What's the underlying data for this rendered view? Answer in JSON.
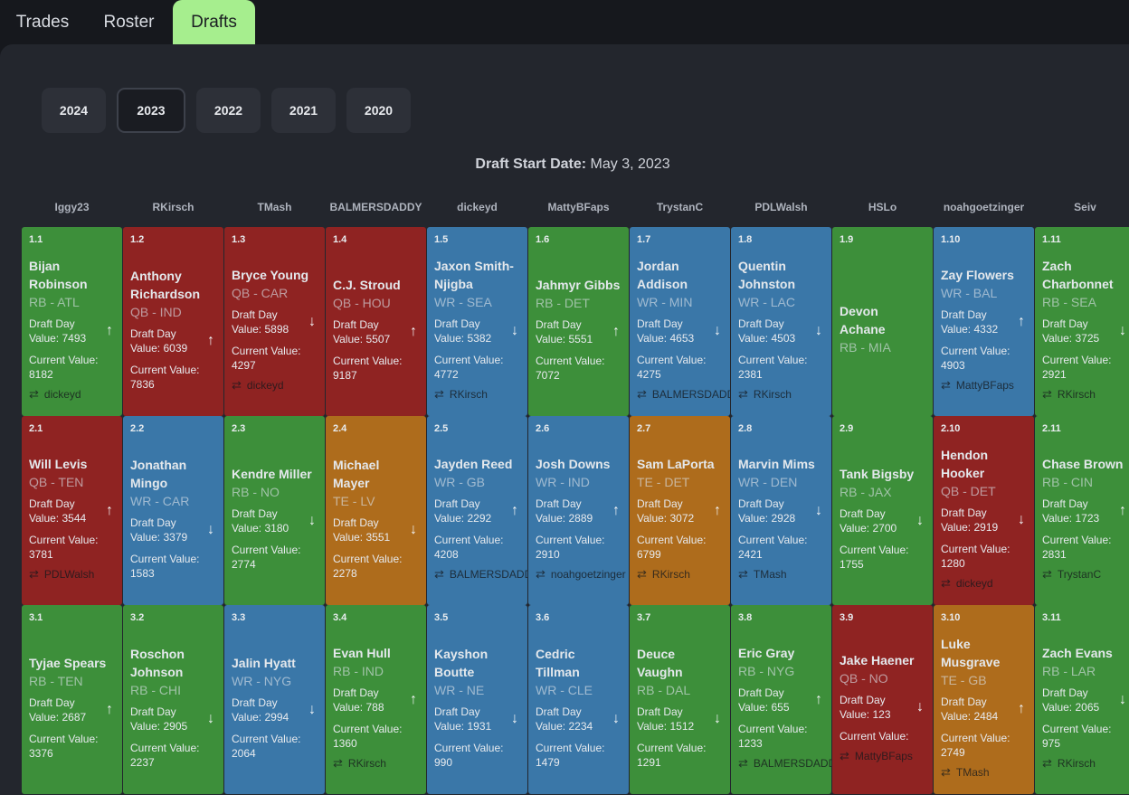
{
  "nav": {
    "tabs": [
      {
        "label": "Trades"
      },
      {
        "label": "Roster"
      },
      {
        "label": "Drafts"
      }
    ]
  },
  "years": [
    "2024",
    "2023",
    "2022",
    "2021",
    "2020"
  ],
  "selected_year": "2023",
  "draft_start": {
    "label": "Draft Start Date:",
    "value": "May 3, 2023"
  },
  "labels": {
    "draft_day": "Draft Day Value:",
    "current": "Current Value:"
  },
  "colors": {
    "RB": "#3d8f3a",
    "QB": "#8f2322",
    "WR": "#3a77a8",
    "TE": "#ae6c1c",
    "active_tab": "#a6ee8e"
  },
  "teams": [
    "Iggy23",
    "RKirsch",
    "TMash",
    "BALMERSDADDY",
    "dickeyd",
    "MattyBFaps",
    "TrystanC",
    "PDLWalsh",
    "HSLo",
    "noahgoetzinger",
    "Seiv"
  ],
  "rounds": [
    [
      {
        "pick": "1.1",
        "name": "Bijan Robinson",
        "pos": "RB - ATL",
        "type": "RB",
        "draft_value": "7493",
        "dir": "up",
        "current_value": "8182",
        "traded_from": "dickeyd"
      },
      {
        "pick": "1.2",
        "name": "Anthony Richardson",
        "pos": "QB - IND",
        "type": "QB",
        "draft_value": "6039",
        "dir": "up",
        "current_value": "7836",
        "traded_from": ""
      },
      {
        "pick": "1.3",
        "name": "Bryce Young",
        "pos": "QB - CAR",
        "type": "QB",
        "draft_value": "5898",
        "dir": "down",
        "current_value": "4297",
        "traded_from": "dickeyd"
      },
      {
        "pick": "1.4",
        "name": "C.J. Stroud",
        "pos": "QB - HOU",
        "type": "QB",
        "draft_value": "5507",
        "dir": "up",
        "current_value": "9187",
        "traded_from": ""
      },
      {
        "pick": "1.5",
        "name": "Jaxon Smith-Njigba",
        "pos": "WR - SEA",
        "type": "WR",
        "draft_value": "5382",
        "dir": "down",
        "current_value": "4772",
        "traded_from": "RKirsch"
      },
      {
        "pick": "1.6",
        "name": "Jahmyr Gibbs",
        "pos": "RB - DET",
        "type": "RB",
        "draft_value": "5551",
        "dir": "up",
        "current_value": "7072",
        "traded_from": ""
      },
      {
        "pick": "1.7",
        "name": "Jordan Addison",
        "pos": "WR - MIN",
        "type": "WR",
        "draft_value": "4653",
        "dir": "down",
        "current_value": "4275",
        "traded_from": "BALMERSDADDY"
      },
      {
        "pick": "1.8",
        "name": "Quentin Johnston",
        "pos": "WR - LAC",
        "type": "WR",
        "draft_value": "4503",
        "dir": "down",
        "current_value": "2381",
        "traded_from": "RKirsch"
      },
      {
        "pick": "1.9",
        "name": "Devon Achane",
        "pos": "RB - MIA",
        "type": "RB",
        "draft_value": "",
        "dir": "",
        "current_value": "",
        "traded_from": ""
      },
      {
        "pick": "1.10",
        "name": "Zay Flowers",
        "pos": "WR - BAL",
        "type": "WR",
        "draft_value": "4332",
        "dir": "up",
        "current_value": "4903",
        "traded_from": "MattyBFaps"
      },
      {
        "pick": "1.11",
        "name": "Zach Charbonnet",
        "pos": "RB - SEA",
        "type": "RB",
        "draft_value": "3725",
        "dir": "down",
        "current_value": "2921",
        "traded_from": "RKirsch"
      }
    ],
    [
      {
        "pick": "2.1",
        "name": "Will Levis",
        "pos": "QB - TEN",
        "type": "QB",
        "draft_value": "3544",
        "dir": "up",
        "current_value": "3781",
        "traded_from": "PDLWalsh"
      },
      {
        "pick": "2.2",
        "name": "Jonathan Mingo",
        "pos": "WR - CAR",
        "type": "WR",
        "draft_value": "3379",
        "dir": "down",
        "current_value": "1583",
        "traded_from": ""
      },
      {
        "pick": "2.3",
        "name": "Kendre Miller",
        "pos": "RB - NO",
        "type": "RB",
        "draft_value": "3180",
        "dir": "down",
        "current_value": "2774",
        "traded_from": ""
      },
      {
        "pick": "2.4",
        "name": "Michael Mayer",
        "pos": "TE - LV",
        "type": "TE",
        "draft_value": "3551",
        "dir": "down",
        "current_value": "2278",
        "traded_from": ""
      },
      {
        "pick": "2.5",
        "name": "Jayden Reed",
        "pos": "WR - GB",
        "type": "WR",
        "draft_value": "2292",
        "dir": "up",
        "current_value": "4208",
        "traded_from": "BALMERSDADDY"
      },
      {
        "pick": "2.6",
        "name": "Josh Downs",
        "pos": "WR - IND",
        "type": "WR",
        "draft_value": "2889",
        "dir": "up",
        "current_value": "2910",
        "traded_from": "noahgoetzinger"
      },
      {
        "pick": "2.7",
        "name": "Sam LaPorta",
        "pos": "TE - DET",
        "type": "TE",
        "draft_value": "3072",
        "dir": "up",
        "current_value": "6799",
        "traded_from": "RKirsch"
      },
      {
        "pick": "2.8",
        "name": "Marvin Mims",
        "pos": "WR - DEN",
        "type": "WR",
        "draft_value": "2928",
        "dir": "down",
        "current_value": "2421",
        "traded_from": "TMash"
      },
      {
        "pick": "2.9",
        "name": "Tank Bigsby",
        "pos": "RB - JAX",
        "type": "RB",
        "draft_value": "2700",
        "dir": "down",
        "current_value": "1755",
        "traded_from": ""
      },
      {
        "pick": "2.10",
        "name": "Hendon Hooker",
        "pos": "QB - DET",
        "type": "QB",
        "draft_value": "2919",
        "dir": "down",
        "current_value": "1280",
        "traded_from": "dickeyd"
      },
      {
        "pick": "2.11",
        "name": "Chase Brown",
        "pos": "RB - CIN",
        "type": "RB",
        "draft_value": "1723",
        "dir": "up",
        "current_value": "2831",
        "traded_from": "TrystanC"
      }
    ],
    [
      {
        "pick": "3.1",
        "name": "Tyjae Spears",
        "pos": "RB - TEN",
        "type": "RB",
        "draft_value": "2687",
        "dir": "up",
        "current_value": "3376",
        "traded_from": ""
      },
      {
        "pick": "3.2",
        "name": "Roschon Johnson",
        "pos": "RB - CHI",
        "type": "RB",
        "draft_value": "2905",
        "dir": "down",
        "current_value": "2237",
        "traded_from": ""
      },
      {
        "pick": "3.3",
        "name": "Jalin Hyatt",
        "pos": "WR - NYG",
        "type": "WR",
        "draft_value": "2994",
        "dir": "down",
        "current_value": "2064",
        "traded_from": ""
      },
      {
        "pick": "3.4",
        "name": "Evan Hull",
        "pos": "RB - IND",
        "type": "RB",
        "draft_value": "788",
        "dir": "up",
        "current_value": "1360",
        "traded_from": "RKirsch"
      },
      {
        "pick": "3.5",
        "name": "Kayshon Boutte",
        "pos": "WR - NE",
        "type": "WR",
        "draft_value": "1931",
        "dir": "down",
        "current_value": "990",
        "traded_from": ""
      },
      {
        "pick": "3.6",
        "name": "Cedric Tillman",
        "pos": "WR - CLE",
        "type": "WR",
        "draft_value": "2234",
        "dir": "down",
        "current_value": "1479",
        "traded_from": ""
      },
      {
        "pick": "3.7",
        "name": "Deuce Vaughn",
        "pos": "RB - DAL",
        "type": "RB",
        "draft_value": "1512",
        "dir": "down",
        "current_value": "1291",
        "traded_from": ""
      },
      {
        "pick": "3.8",
        "name": "Eric Gray",
        "pos": "RB - NYG",
        "type": "RB",
        "draft_value": "655",
        "dir": "up",
        "current_value": "1233",
        "traded_from": "BALMERSDADDY"
      },
      {
        "pick": "3.9",
        "name": "Jake Haener",
        "pos": "QB - NO",
        "type": "QB",
        "draft_value": "123",
        "dir": "down",
        "current_value": "",
        "traded_from": "MattyBFaps"
      },
      {
        "pick": "3.10",
        "name": "Luke Musgrave",
        "pos": "TE - GB",
        "type": "TE",
        "draft_value": "2484",
        "dir": "up",
        "current_value": "2749",
        "traded_from": "TMash"
      },
      {
        "pick": "3.11",
        "name": "Zach Evans",
        "pos": "RB - LAR",
        "type": "RB",
        "draft_value": "2065",
        "dir": "down",
        "current_value": "975",
        "traded_from": "RKirsch"
      }
    ]
  ]
}
